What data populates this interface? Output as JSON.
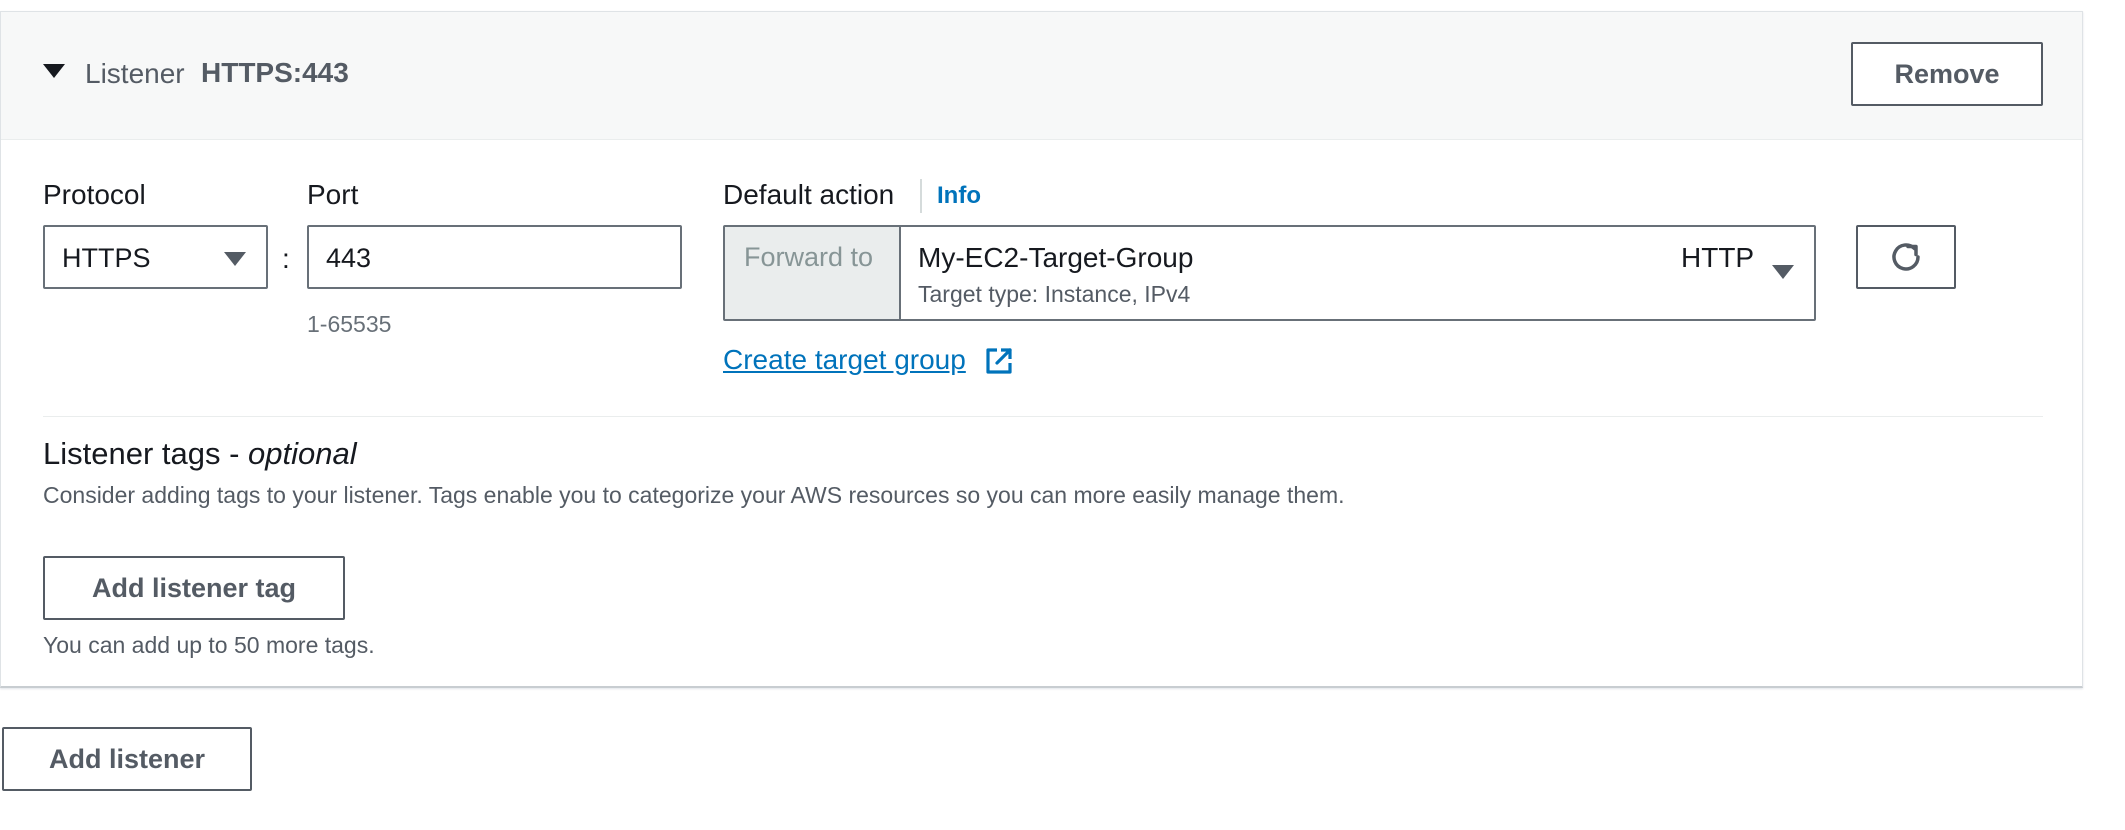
{
  "listener": {
    "header_label": "Listener",
    "header_value": "HTTPS:443",
    "remove_label": "Remove"
  },
  "protocol": {
    "label": "Protocol",
    "value": "HTTPS"
  },
  "port": {
    "label": "Port",
    "value": "443",
    "hint": "1-65535"
  },
  "default_action": {
    "label": "Default action",
    "info_label": "Info",
    "forward_label": "Forward to",
    "target_group_name": "My-EC2-Target-Group",
    "target_group_detail": "Target type: Instance, IPv4",
    "target_group_protocol": "HTTP",
    "create_target_group_label": "Create target group"
  },
  "tags": {
    "title": "Listener tags - ",
    "title_optional": "optional",
    "description": "Consider adding tags to your listener. Tags enable you to categorize your AWS resources so you can more easily manage them.",
    "add_button_label": "Add listener tag",
    "limit_text": "You can add up to 50 more tags."
  },
  "footer": {
    "add_listener_label": "Add listener"
  },
  "icons": {
    "expand": "caret-down-icon",
    "dropdown": "chevron-down-icon",
    "refresh": "refresh-icon",
    "external_link": "external-link-icon"
  },
  "colors": {
    "link": "#0073bb",
    "border": "#687078",
    "header_bg": "#f7f8f8",
    "addon_bg": "#eaeded",
    "text": "#16191f",
    "secondary_text": "#545b64"
  }
}
